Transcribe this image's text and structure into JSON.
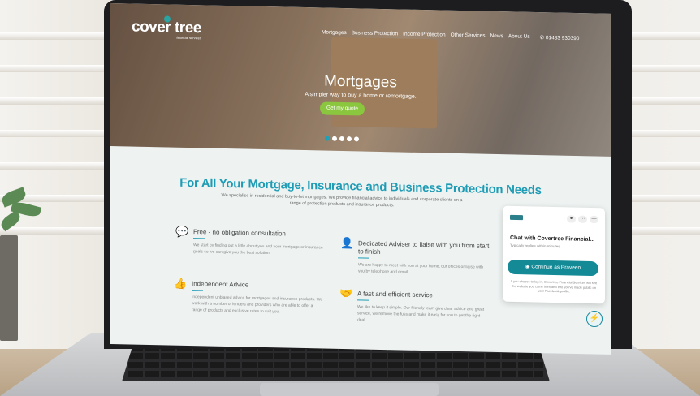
{
  "site": {
    "logo_text": "cover tree",
    "logo_tagline": "financial services",
    "nav": [
      "Mortgages",
      "Business Protection",
      "Income Protection",
      "Other Services",
      "News",
      "About Us"
    ],
    "phone": "01483 930390"
  },
  "hero": {
    "title": "Mortgages",
    "subtitle": "A simpler way to buy a home or remortgage.",
    "cta": "Get my quote",
    "slides": 5,
    "active_slide": 1
  },
  "main": {
    "heading": "For All Your Mortgage, Insurance and Business Protection Needs",
    "intro": "We specialise in residential and buy-to-let mortgages. We provide financial advice to individuals and corporate clients on a range of protection products and insurance products.",
    "features": [
      {
        "title": "Free - no obligation consultation",
        "text": "We start by finding out a little about you and your mortgage or insurance goals so we can give you the best solution.",
        "icon": "chat-bubbles-icon"
      },
      {
        "title": "Dedicated Adviser to liaise with you from start to finish",
        "text": "We are happy to meet with you at your home, our offices or liaise with you by telephone and email.",
        "icon": "person-icon"
      },
      {
        "title": "Independent Advice",
        "text": "Independent unbiased advice for mortgages and insurance products. We work with a number of lenders and providers who are able to offer a range of products and exclusive rates to suit you.",
        "icon": "thumbs-up-icon"
      },
      {
        "title": "A fast and efficient service",
        "text": "We like to keep it simple. Our friendly team give clear advice and great service, we remove the fuss and make it easy for you to get the right deal.",
        "icon": "handshake-icon"
      }
    ]
  },
  "chat": {
    "title": "Chat with Covertree Financial...",
    "subtitle": "Typically replies within minutes",
    "button": "Continue as Praveen",
    "note": "If you choose to log in, Covertree Financial Services will see the website you came from and info you've made public on your Facebook profile.",
    "ctrl_more": "···",
    "ctrl_close": "—"
  },
  "colors": {
    "accent": "#1f9cb5",
    "green": "#8bc63f",
    "chat_button": "#138a96"
  }
}
